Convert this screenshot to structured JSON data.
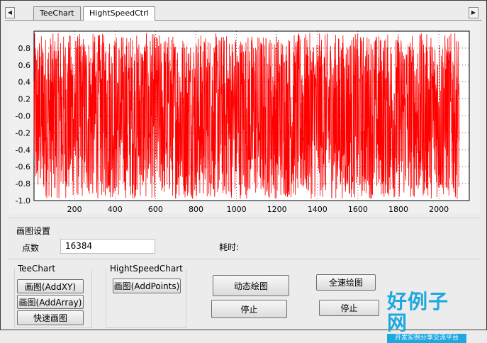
{
  "tabs": [
    {
      "label": "TeeChart",
      "active": false
    },
    {
      "label": "HightSpeedCtrl",
      "active": true
    }
  ],
  "tab_scroll": {
    "left": "◀",
    "right": "▶"
  },
  "chart_data": {
    "type": "line",
    "title": "",
    "xlabel": "",
    "ylabel": "",
    "xlim": [
      0,
      2150
    ],
    "ylim": [
      -1.0,
      1.0
    ],
    "x_ticks": [
      200,
      400,
      600,
      800,
      1000,
      1200,
      1400,
      1600,
      1800,
      2000
    ],
    "y_ticks": [
      "0.8",
      "0.6",
      "0.4",
      "0.2",
      "-0.0",
      "-0.2",
      "-0.4",
      "-0.6",
      "-0.8",
      "-1.0"
    ],
    "y_tick_values": [
      0.8,
      0.6,
      0.4,
      0.2,
      0.0,
      -0.2,
      -0.4,
      -0.6,
      -0.8,
      -1.0
    ],
    "grid": true,
    "series": [
      {
        "description": "random noise signal, values between -1.0 and 1.0 across x 0–2100",
        "color": "#ff0000"
      }
    ]
  },
  "settings": {
    "section_label": "画图设置",
    "points_label": "点数",
    "points_value": "16384",
    "elapsed_label": "耗时:"
  },
  "teechart_group": {
    "title": "TeeChart",
    "buttons": [
      "画图(AddXY)",
      "画图(AddArray)",
      "快速画图"
    ]
  },
  "highspeed_group": {
    "title": "HightSpeedChart",
    "buttons": [
      "画图(AddPoints)"
    ]
  },
  "actions": {
    "dynamic_draw": "动态绘图",
    "stop1": "停止",
    "full_speed_draw": "全速绘图",
    "stop2": "停止"
  },
  "watermark": {
    "logo_text": "好例子网",
    "logo_subtitle": "开发实例分享交流平台",
    "logo_color": "#1ea8e0"
  },
  "colors": {
    "series": "#ff0000",
    "grid": "#000000",
    "plot_bg": "#ffffff"
  }
}
